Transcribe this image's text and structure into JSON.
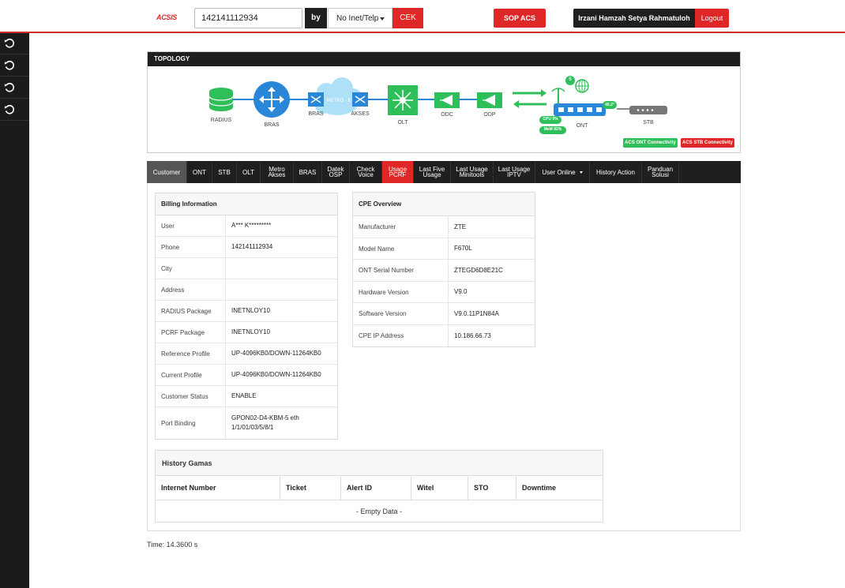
{
  "header": {
    "logo": "ACSIS",
    "search_value": "142141112934",
    "by_label": "by",
    "search_type": "No Inet/Telp",
    "cek_label": "CEK",
    "sop_label": "SOP ACS",
    "user_name": "Irzani Hamzah Setya Rahmatuloh",
    "logout_label": "Logout"
  },
  "topology": {
    "title": "TOPOLOGY",
    "nodes": {
      "radius": "RADIUS",
      "bras": "BRAS",
      "bras2": "BRAS",
      "metro": "METRO - E",
      "akses": "AKSES",
      "olt": "OLT",
      "odc": "ODC",
      "odp": "ODP",
      "ont": "ONT",
      "stb": "STB"
    },
    "ont_badge_count": "5",
    "ont_temp": "45.2°",
    "cpu": "CPU 9%",
    "mem": "MeM 82%",
    "acs_ont": "ACS ONT Connectivity",
    "acs_stb": "ACS STB Connectivity",
    "colors": {
      "accent_green": "#2fbf5a",
      "accent_blue": "#2a86d6",
      "red": "#e02727"
    }
  },
  "tabs": [
    {
      "label": "Customer",
      "state": "grey"
    },
    {
      "label": "ONT"
    },
    {
      "label": "STB"
    },
    {
      "label": "OLT"
    },
    {
      "label": "Metro Akses",
      "l1": "Metro",
      "l2": "Akses"
    },
    {
      "label": "BRAS"
    },
    {
      "label": "Datek OSP",
      "l1": "Datek",
      "l2": "OSP"
    },
    {
      "label": "Check Voice",
      "l1": "Check",
      "l2": "Voice"
    },
    {
      "label": "Usage PCRF",
      "l1": "Usage",
      "l2": "PCRF",
      "state": "red"
    },
    {
      "label": "Last Five Usage",
      "l1": "Last Five",
      "l2": "Usage"
    },
    {
      "label": "Last Usage Minitools",
      "l1": "Last Usage",
      "l2": "Minitools"
    },
    {
      "label": "Last Usage IPTV",
      "l1": "Last Usage",
      "l2": "IPTV"
    },
    {
      "label": "User Online",
      "caret": true
    },
    {
      "label": "History Action"
    },
    {
      "label": "Panduan Solusi",
      "l1": "Panduan",
      "l2": "Solusi"
    }
  ],
  "billing": {
    "title": "Billing Information",
    "rows": [
      {
        "key": "User",
        "value": "A*** K*********"
      },
      {
        "key": "Phone",
        "value": "142141112934"
      },
      {
        "key": "City",
        "value": ""
      },
      {
        "key": "Address",
        "value": ""
      },
      {
        "key": "RADIUS Package",
        "value": "INETNLOY10"
      },
      {
        "key": "PCRF Package",
        "value": "INETNLOY10"
      },
      {
        "key": "Reference Profile",
        "value": "UP-4096KB0/DOWN-11264KB0"
      },
      {
        "key": "Current Profile",
        "value": "UP-4096KB0/DOWN-11264KB0"
      },
      {
        "key": "Customer Status",
        "value": "ENABLE"
      },
      {
        "key": "Port Binding",
        "value": "GPON02-D4-KBM-5 eth 1/1/01/03/5/8/1"
      }
    ]
  },
  "cpe": {
    "title": "CPE Overview",
    "rows": [
      {
        "key": "Manufacturer",
        "value": "ZTE"
      },
      {
        "key": "Model Name",
        "value": "F670L"
      },
      {
        "key": "ONT Serial Number",
        "value": "ZTEGD6D8E21C"
      },
      {
        "key": "Hardware Version",
        "value": "V9.0"
      },
      {
        "key": "Software Version",
        "value": "V9.0.11P1N84A"
      },
      {
        "key": "CPE IP Address",
        "value": "10.186.66.73"
      }
    ]
  },
  "history": {
    "title": "History Gamas",
    "columns": [
      "Internet Number",
      "Ticket",
      "Alert ID",
      "Witel",
      "STO",
      "Downtime"
    ],
    "empty": "- Empty Data -"
  },
  "footer": {
    "time": "Time: 14.3600 s"
  }
}
